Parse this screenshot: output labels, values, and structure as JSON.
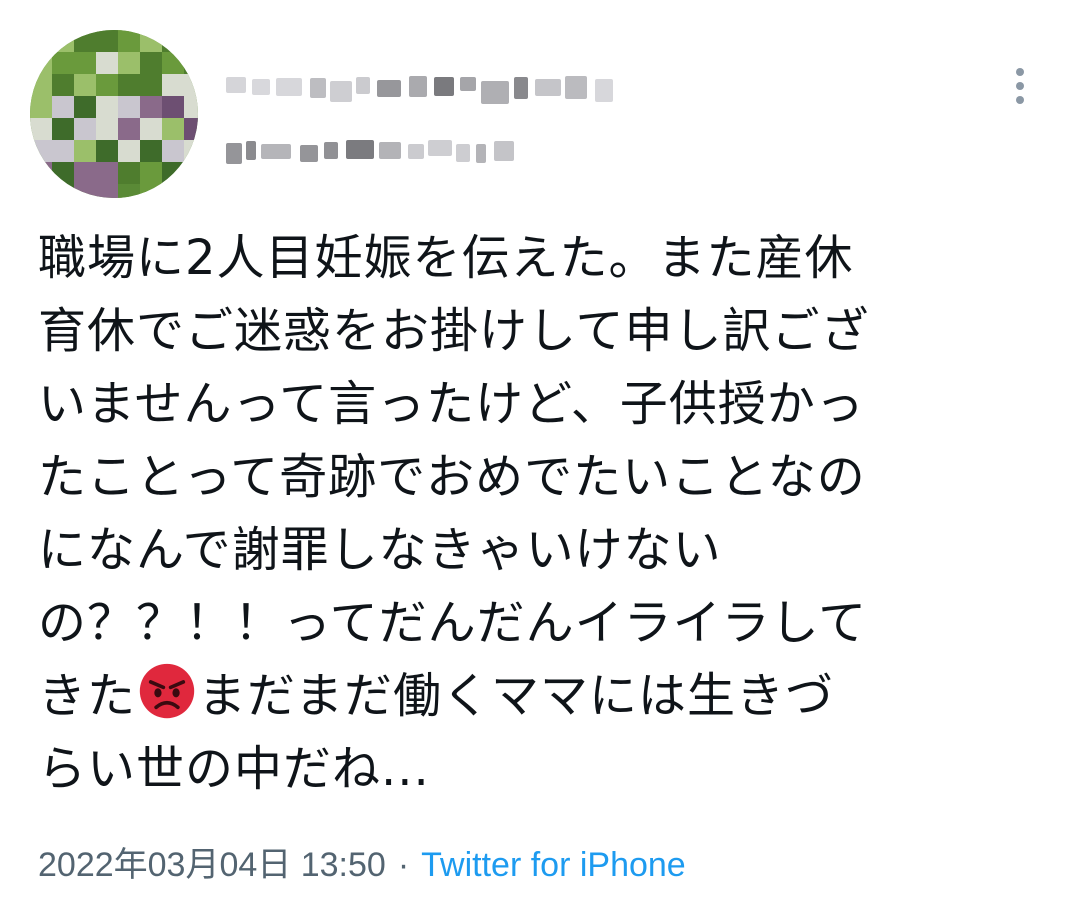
{
  "author": {
    "display_name": "",
    "handle": ""
  },
  "tweet": {
    "lines": [
      "職場に2人目妊娠を伝えた。また産休",
      "育休でご迷惑をお掛けして申し訳ござ",
      "いませんって言ったけど、子供授かっ",
      "たことって奇跡でおめでたいことなの",
      "になんで謝罪しなきゃいけない",
      "の？？！！ってだんだんイライラして"
    ],
    "emoji_line_before": "きた",
    "emoji_name": "angry-face-emoji",
    "emoji_line_after": "まだまだ働くママには生きづ",
    "last_line": "らい世の中だね..."
  },
  "meta": {
    "timestamp": "2022年03月04日 13:50",
    "separator": "·",
    "source": "Twitter for iPhone"
  },
  "colors": {
    "text": "#0f1419",
    "meta_text": "#536471",
    "link": "#1d9bf0",
    "emoji_face": "#e0283d"
  }
}
